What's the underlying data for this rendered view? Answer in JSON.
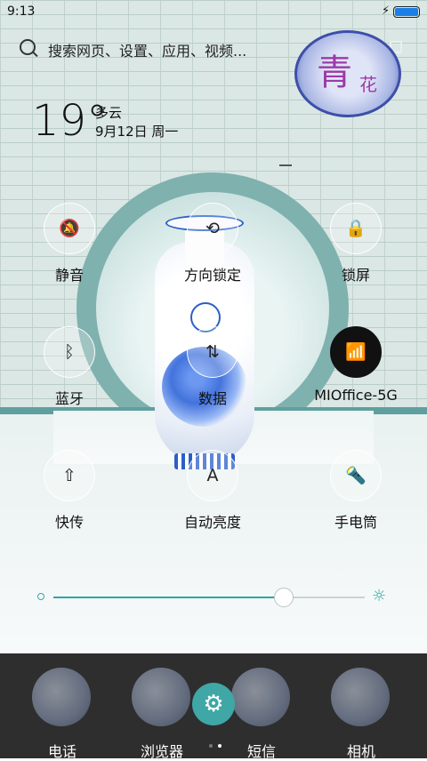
{
  "status_bar": {
    "time": "9:13",
    "charging_icon": "bolt-icon",
    "battery_level": 100
  },
  "search": {
    "placeholder": "搜索网页、设置、应用、视频..."
  },
  "weather": {
    "temperature": "19°",
    "condition": "多云",
    "date": "9月12日 周一"
  },
  "seal": {
    "char_main": "青",
    "char_small": "花"
  },
  "quick_settings": [
    {
      "id": "mute",
      "label": "静音",
      "icon": "bell-off-icon",
      "glyph": "🔕",
      "active": false
    },
    {
      "id": "rotation-lock",
      "label": "方向锁定",
      "icon": "rotation-lock-icon",
      "glyph": "⟲",
      "active": false
    },
    {
      "id": "lock-screen",
      "label": "锁屏",
      "icon": "lock-icon",
      "glyph": "🔒",
      "active": false
    },
    {
      "id": "bluetooth",
      "label": "蓝牙",
      "icon": "bluetooth-icon",
      "glyph": "ᛒ",
      "active": false
    },
    {
      "id": "mobile-data",
      "label": "数据",
      "icon": "data-arrows-icon",
      "glyph": "⇅",
      "active": false
    },
    {
      "id": "wifi",
      "label": "MIOffice-5G",
      "icon": "wifi-icon",
      "glyph": "📶",
      "active": true
    },
    {
      "id": "quick-transfer",
      "label": "快传",
      "icon": "upload-circle-icon",
      "glyph": "⇧",
      "active": false
    },
    {
      "id": "auto-brightness",
      "label": "自动亮度",
      "icon": "auto-brightness-icon",
      "glyph": "A",
      "active": false
    },
    {
      "id": "flashlight",
      "label": "手电筒",
      "icon": "flashlight-icon",
      "glyph": "🔦",
      "active": false
    }
  ],
  "brightness": {
    "level": 0.74,
    "min_icon": "brightness-low-icon",
    "max_icon": "sun-icon",
    "max_glyph": "☼"
  },
  "dock": {
    "apps": [
      {
        "label": "电话",
        "icon": "phone-app-icon"
      },
      {
        "label": "浏览器",
        "icon": "browser-app-icon"
      },
      {
        "label": "短信",
        "icon": "messages-app-icon"
      },
      {
        "label": "相机",
        "icon": "camera-app-icon"
      }
    ],
    "settings_icon": "gear-icon",
    "settings_glyph": "⚙",
    "pages": 2,
    "current_page": 2
  },
  "colors": {
    "accent": "#3fa7a6",
    "active_tile": "#111111",
    "dock_bg": "#2e2e2e"
  }
}
